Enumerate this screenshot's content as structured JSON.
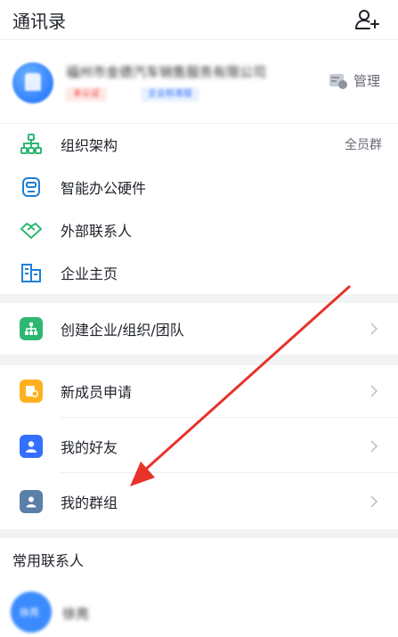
{
  "header": {
    "title": "通讯录"
  },
  "org": {
    "name": "福州市金德汽车销售服务有限公司",
    "tag_primary": "未认证",
    "tag_secondary": "企业标准版",
    "manage_label": "管理"
  },
  "menu": {
    "org_structure": "组织架构",
    "all_members_group": "全员群",
    "smart_hardware": "智能办公硬件",
    "external_contacts": "外部联系人",
    "company_homepage": "企业主页",
    "create_org": "创建企业/组织/团队",
    "new_member_requests": "新成员申请",
    "my_friends": "我的好友",
    "my_groups": "我的群组"
  },
  "frequent": {
    "title": "常用联系人",
    "contact_name": "徐亮",
    "contact_avatar_text": "徐亮"
  },
  "colors": {
    "accent_blue": "#3370ff",
    "green": "#2eb872",
    "orange": "#ffb020",
    "steel_blue": "#5a7fa8",
    "arrow_red": "#e8322a"
  }
}
